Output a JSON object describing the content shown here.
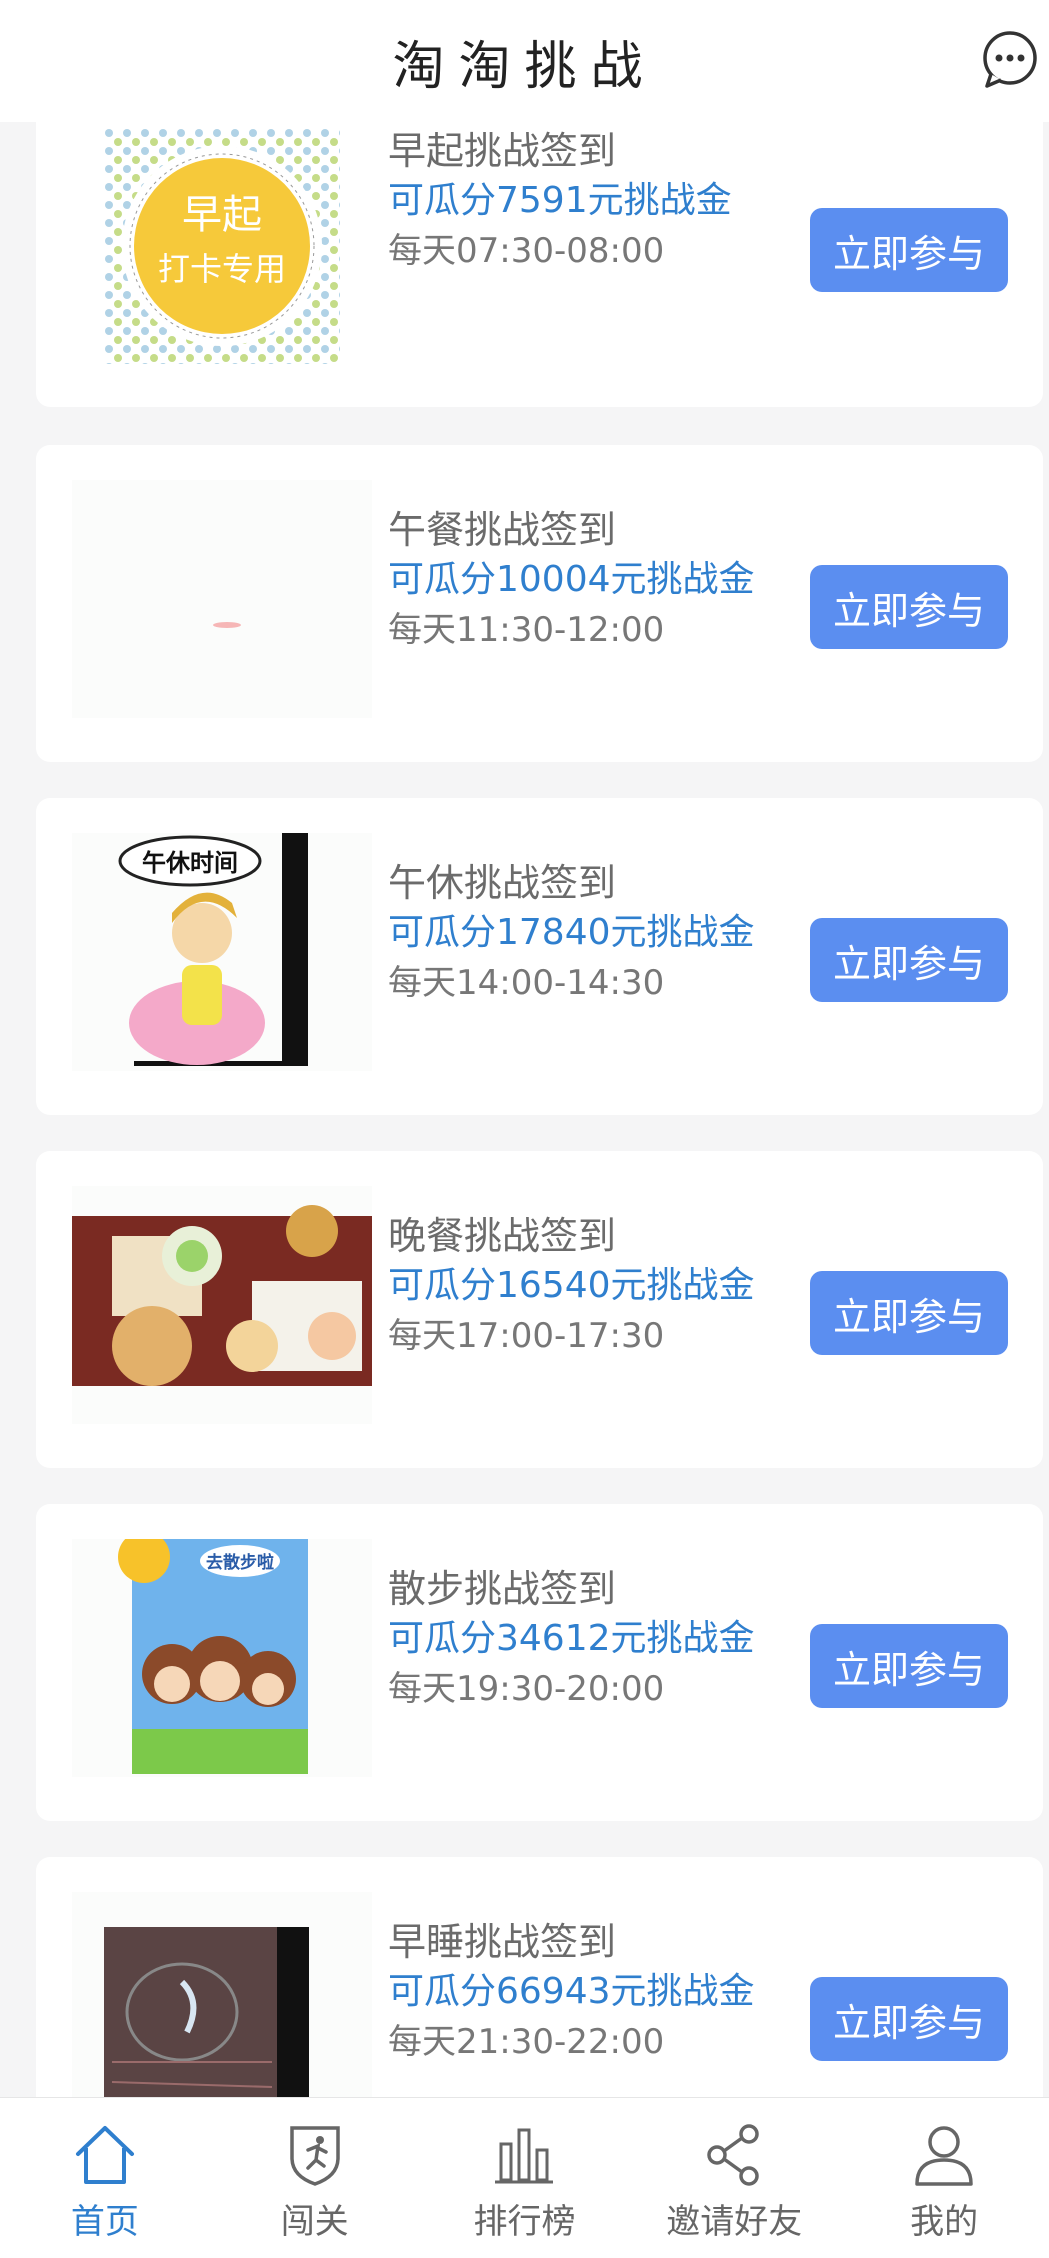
{
  "header": {
    "title": "淘淘挑战"
  },
  "challenges": [
    {
      "title": "早起挑战签到",
      "prize": "可瓜分7591元挑战金",
      "time": "每天07:30-08:00",
      "button": "立即参与",
      "thumb_text": [
        "早起",
        "打卡专用"
      ]
    },
    {
      "title": "午餐挑战签到",
      "prize": "可瓜分10004元挑战金",
      "time": "每天11:30-12:00",
      "button": "立即参与"
    },
    {
      "title": "午休挑战签到",
      "prize": "可瓜分17840元挑战金",
      "time": "每天14:00-14:30",
      "button": "立即参与",
      "thumb_text": [
        "午休时间"
      ]
    },
    {
      "title": "晚餐挑战签到",
      "prize": "可瓜分16540元挑战金",
      "time": "每天17:00-17:30",
      "button": "立即参与"
    },
    {
      "title": "散步挑战签到",
      "prize": "可瓜分34612元挑战金",
      "time": "每天19:30-20:00",
      "button": "立即参与",
      "thumb_text": [
        "去散步啦"
      ]
    },
    {
      "title": "早睡挑战签到",
      "prize": "可瓜分66943元挑战金",
      "time": "每天21:30-22:00",
      "button": "立即参与"
    }
  ],
  "tabbar": {
    "items": [
      {
        "label": "首页",
        "icon": "home-icon",
        "active": true
      },
      {
        "label": "闯关",
        "icon": "shield-runner-icon"
      },
      {
        "label": "排行榜",
        "icon": "bar-chart-icon"
      },
      {
        "label": "邀请好友",
        "icon": "share-icon"
      },
      {
        "label": "我的",
        "icon": "user-icon"
      }
    ]
  },
  "colors": {
    "accent": "#5b8ef0",
    "link": "#2f7fce",
    "background": "#f5f5f6"
  }
}
